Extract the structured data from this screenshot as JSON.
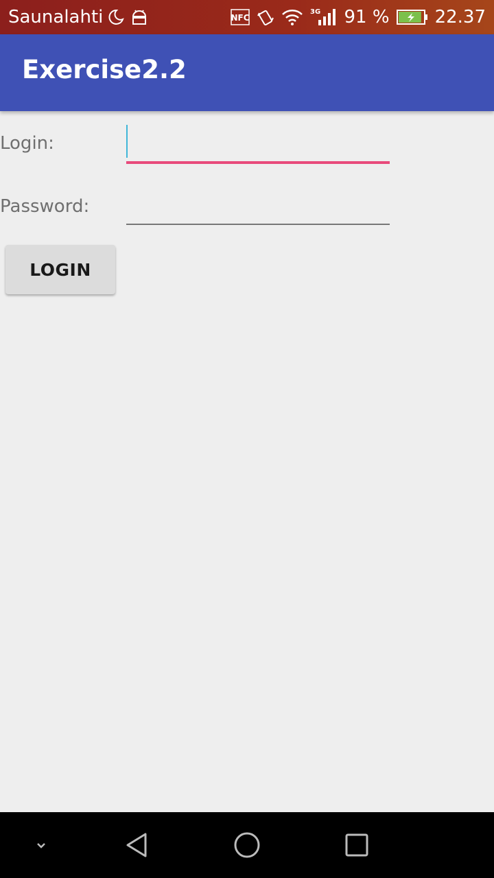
{
  "status_bar": {
    "carrier": "Saunalahti",
    "nfc": "NFC",
    "network": "3G",
    "battery": "91 %",
    "time": "22.37",
    "icons": [
      "moon-icon",
      "android-icon",
      "nfc-icon",
      "vibrate-icon",
      "wifi-icon",
      "signal-icon",
      "battery-charging-icon"
    ],
    "battery_level": 0.91
  },
  "app_bar": {
    "title": "Exercise2.2",
    "color": "#3f51b5"
  },
  "form": {
    "login_label": "Login:",
    "login_value": "",
    "password_label": "Password:",
    "password_value": "",
    "login_button": "LOGIN",
    "accent_color": "#e84a7b"
  },
  "nav_bar": {
    "icons": [
      "chevron-down-icon",
      "back-icon",
      "home-icon",
      "recents-icon"
    ]
  }
}
